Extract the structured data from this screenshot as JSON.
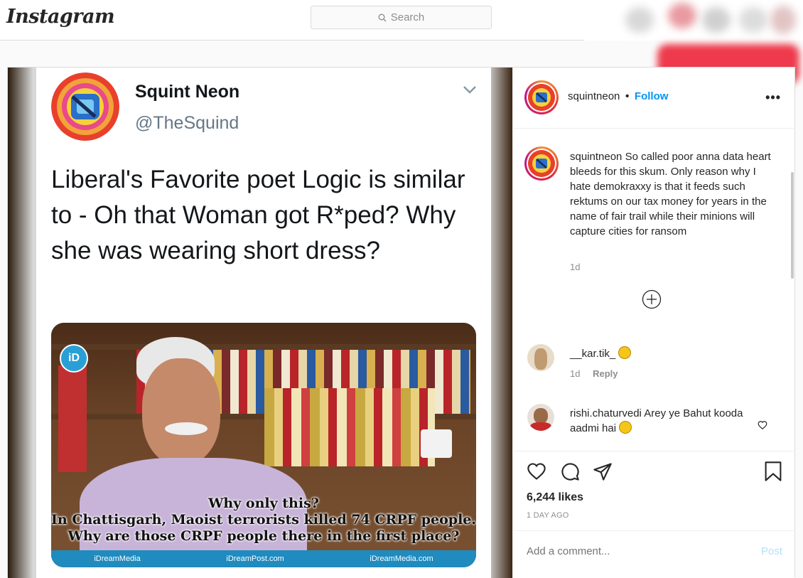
{
  "topbar": {
    "logo": "Instagram",
    "search_placeholder": "Search"
  },
  "tweet": {
    "name": "Squint Neon",
    "handle": "@TheSquind",
    "text": "Liberal's Favorite poet Logic is similar to - Oh that Woman got R*ped? Why she was wearing short dress?",
    "image": {
      "caption_line1": "Why only this?",
      "caption_line2": "In Chattisgarh, Maoist terrorists killed 74 CRPF people.",
      "caption_line3": "Why are those CRPF people there in the first place?",
      "logo": "iD",
      "strip_left": "iDreamMedia",
      "strip_mid": "iDreamPost.com",
      "strip_right": "iDreamMedia.com"
    }
  },
  "post": {
    "username": "squintneon",
    "follow_label": "Follow",
    "separator": "•",
    "more_label": "•••",
    "caption": {
      "username": "squintneon",
      "text": "So called poor anna data heart bleeds for this skum. Only reason why I hate demokraxxy is that it feeds such rektums on our tax money for years in the name of fair trail while their minions will capture cities for ransom",
      "time": "1d"
    },
    "comments": [
      {
        "username": "__kar.tik_",
        "text": "",
        "emoji": "smiling-face",
        "time": "1d",
        "reply_label": "Reply"
      },
      {
        "username": "rishi.chaturvedi",
        "text": "Arey ye Bahut kooda aadmi hai",
        "emoji": "expressionless-face"
      }
    ],
    "likes": "6,244 likes",
    "date": "1 DAY AGO",
    "add_comment_placeholder": "Add a comment...",
    "post_label": "Post"
  },
  "colors": {
    "accent": "#0095f6",
    "text": "#262626",
    "muted": "#8e8e8e",
    "border": "#dbdbdb"
  }
}
